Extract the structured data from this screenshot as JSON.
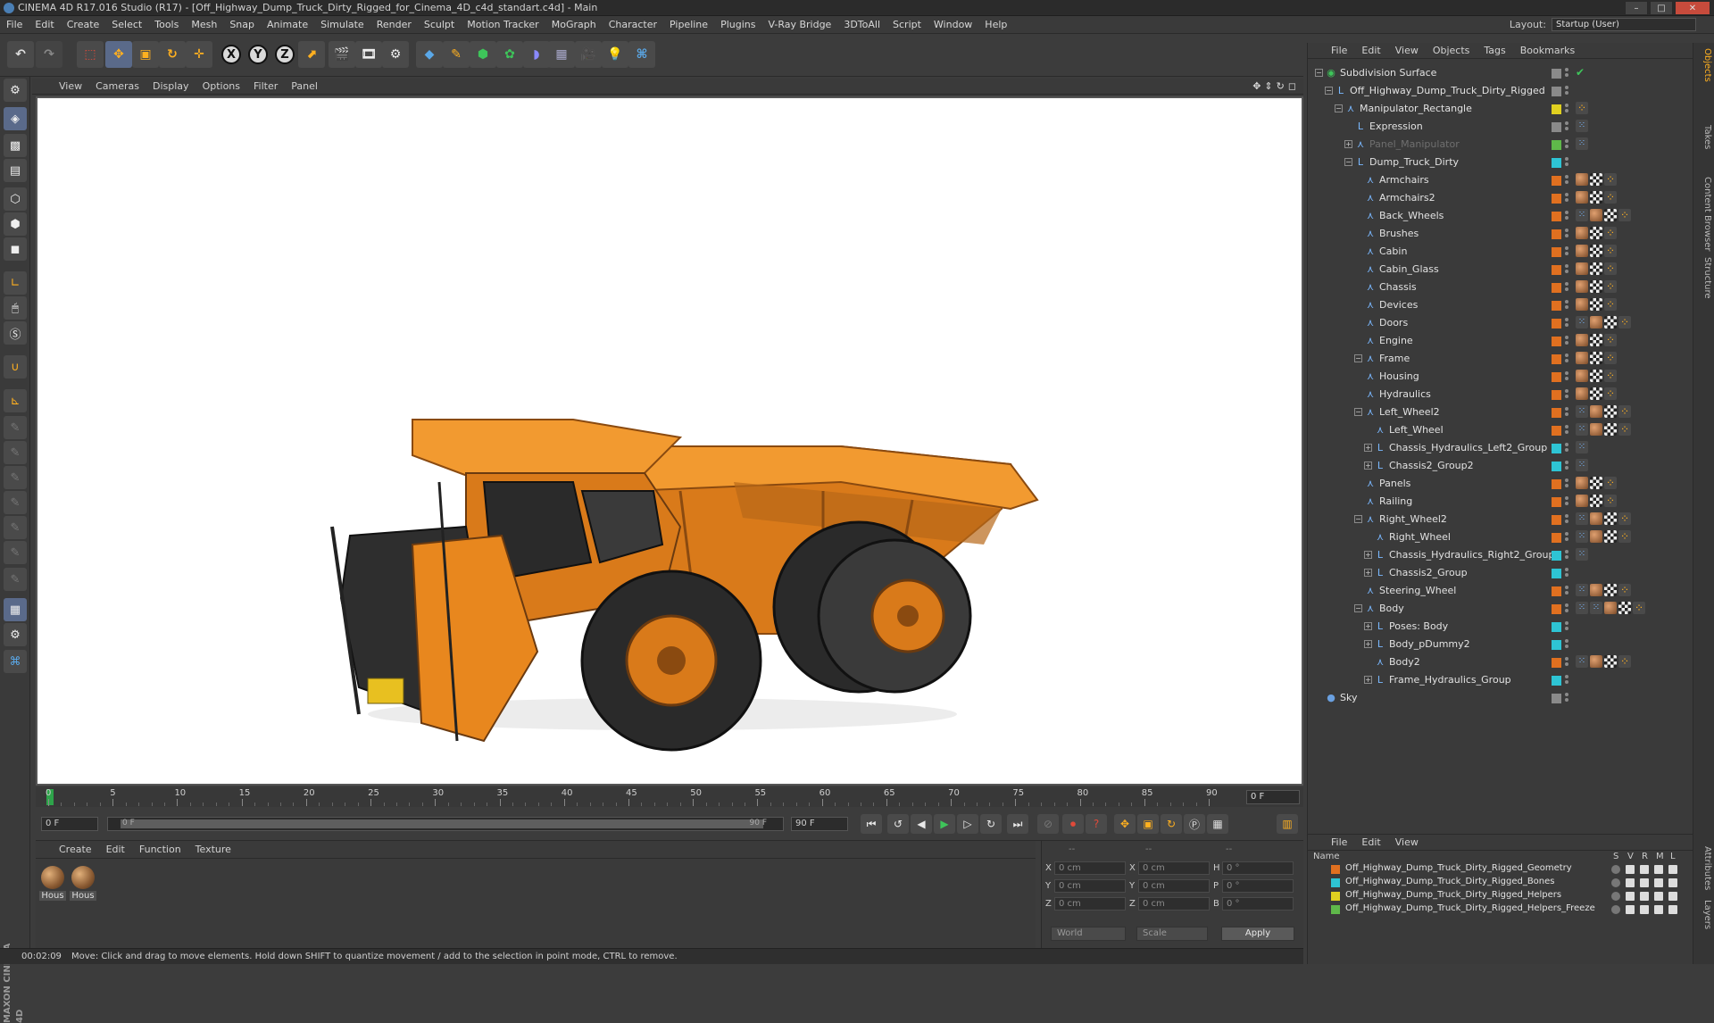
{
  "window": {
    "title": "CINEMA 4D R17.016 Studio (R17) - [Off_Highway_Dump_Truck_Dirty_Rigged_for_Cinema_4D_c4d_standart.c4d] - Main",
    "controls": [
      "–",
      "□",
      "✕"
    ]
  },
  "menubar": {
    "items": [
      "File",
      "Edit",
      "Create",
      "Select",
      "Tools",
      "Mesh",
      "Snap",
      "Animate",
      "Simulate",
      "Render",
      "Sculpt",
      "Motion Tracker",
      "MoGraph",
      "Character",
      "Pipeline",
      "Plugins",
      "V-Ray Bridge",
      "3DToAll",
      "Script",
      "Window",
      "Help"
    ],
    "layout_label": "Layout:",
    "layout_value": "Startup (User)"
  },
  "toolbar": {
    "axis_x": "X",
    "axis_y": "Y",
    "axis_z": "Z"
  },
  "viewport": {
    "menu": [
      "View",
      "Cameras",
      "Display",
      "Options",
      "Filter",
      "Panel"
    ],
    "colors": {
      "body": "#e8871e",
      "tire": "#2a2a2a",
      "rim": "#d97a1a"
    }
  },
  "timeline": {
    "ticks": [
      "0",
      "5",
      "10",
      "15",
      "20",
      "25",
      "30",
      "35",
      "40",
      "45",
      "50",
      "55",
      "60",
      "65",
      "70",
      "75",
      "80",
      "85",
      "90"
    ],
    "current_frame": "0 F"
  },
  "transport": {
    "start_field": "0 F",
    "slider_left": "0 F",
    "slider_right": "90 F",
    "end_field": "90 F"
  },
  "material_manager": {
    "menu": [
      "Create",
      "Edit",
      "Function",
      "Texture"
    ],
    "materials": [
      {
        "label": "Hous"
      },
      {
        "label": "Hous"
      }
    ]
  },
  "coordinates": {
    "headers": [
      "--",
      "--",
      "--"
    ],
    "rows": [
      {
        "a": "X",
        "v1": "0 cm",
        "b": "X",
        "v2": "0 cm",
        "c": "H",
        "v3": "0 °"
      },
      {
        "a": "Y",
        "v1": "0 cm",
        "b": "Y",
        "v2": "0 cm",
        "c": "P",
        "v3": "0 °"
      },
      {
        "a": "Z",
        "v1": "0 cm",
        "b": "Z",
        "v2": "0 cm",
        "c": "B",
        "v3": "0 °"
      }
    ],
    "mode": "World",
    "transform": "Scale",
    "apply": "Apply"
  },
  "status": {
    "time": "00:02:09",
    "message": "Move: Click and drag to move elements. Hold down SHIFT to quantize movement / add to the selection in point mode, CTRL to remove."
  },
  "object_manager": {
    "menu": [
      "File",
      "Edit",
      "View",
      "Objects",
      "Tags",
      "Bookmarks"
    ],
    "objects": [
      {
        "name": "Subdivision Surface",
        "indent": 0,
        "icon": "subdivision-icon",
        "layer": "#8a8a8a",
        "tags": [
          "check"
        ]
      },
      {
        "name": "Off_Highway_Dump_Truck_Dirty_Rigged",
        "indent": 1,
        "icon": "null-icon",
        "layer": "#8a8a8a",
        "tags": []
      },
      {
        "name": "Manipulator_Rectangle",
        "indent": 2,
        "icon": "joint-icon",
        "layer": "#e0d020",
        "tags": [
          "uv"
        ]
      },
      {
        "name": "Expression",
        "indent": 3,
        "icon": "null-icon",
        "layer": "#8a8a8a",
        "tags": [
          "rig"
        ]
      },
      {
        "name": "Panel_Manipulator",
        "indent": 3,
        "icon": "joint-icon",
        "layer": "#5fb84a",
        "tags": [
          "rig"
        ],
        "dim": true
      },
      {
        "name": "Dump_Truck_Dirty",
        "indent": 3,
        "icon": "null-icon",
        "layer": "#2ec4d4",
        "tags": []
      },
      {
        "name": "Armchairs",
        "indent": 4,
        "icon": "joint-icon",
        "layer": "#e07020",
        "tags": [
          "mat",
          "chk",
          "uv"
        ]
      },
      {
        "name": "Armchairs2",
        "indent": 4,
        "icon": "joint-icon",
        "layer": "#e07020",
        "tags": [
          "mat",
          "chk",
          "uv"
        ]
      },
      {
        "name": "Back_Wheels",
        "indent": 4,
        "icon": "joint-icon",
        "layer": "#e07020",
        "tags": [
          "rig",
          "mat",
          "chk",
          "uv"
        ]
      },
      {
        "name": "Brushes",
        "indent": 4,
        "icon": "joint-icon",
        "layer": "#e07020",
        "tags": [
          "mat",
          "chk",
          "uv"
        ]
      },
      {
        "name": "Cabin",
        "indent": 4,
        "icon": "joint-icon",
        "layer": "#e07020",
        "tags": [
          "mat",
          "chk",
          "uv"
        ]
      },
      {
        "name": "Cabin_Glass",
        "indent": 4,
        "icon": "joint-icon",
        "layer": "#e07020",
        "tags": [
          "mat",
          "chk",
          "uv"
        ]
      },
      {
        "name": "Chassis",
        "indent": 4,
        "icon": "joint-icon",
        "layer": "#e07020",
        "tags": [
          "mat",
          "chk",
          "uv"
        ]
      },
      {
        "name": "Devices",
        "indent": 4,
        "icon": "joint-icon",
        "layer": "#e07020",
        "tags": [
          "mat",
          "chk",
          "uv"
        ]
      },
      {
        "name": "Doors",
        "indent": 4,
        "icon": "joint-icon",
        "layer": "#e07020",
        "tags": [
          "rig",
          "mat",
          "chk",
          "uv"
        ]
      },
      {
        "name": "Engine",
        "indent": 4,
        "icon": "joint-icon",
        "layer": "#e07020",
        "tags": [
          "mat",
          "chk",
          "uv"
        ]
      },
      {
        "name": "Frame",
        "indent": 4,
        "icon": "joint-icon",
        "layer": "#e07020",
        "tags": [
          "mat",
          "chk",
          "uv"
        ],
        "expand": true
      },
      {
        "name": "Housing",
        "indent": 4,
        "icon": "joint-icon",
        "layer": "#e07020",
        "tags": [
          "mat",
          "chk",
          "uv"
        ]
      },
      {
        "name": "Hydraulics",
        "indent": 4,
        "icon": "joint-icon",
        "layer": "#e07020",
        "tags": [
          "mat",
          "chk",
          "uv"
        ]
      },
      {
        "name": "Left_Wheel2",
        "indent": 4,
        "icon": "joint-icon",
        "layer": "#e07020",
        "tags": [
          "rig",
          "mat",
          "chk",
          "uv"
        ],
        "expand": true
      },
      {
        "name": "Left_Wheel",
        "indent": 5,
        "icon": "joint-icon",
        "layer": "#e07020",
        "tags": [
          "rig",
          "mat",
          "chk",
          "uv"
        ]
      },
      {
        "name": "Chassis_Hydraulics_Left2_Group",
        "indent": 5,
        "icon": "null-icon",
        "layer": "#2ec4d4",
        "tags": [
          "rig"
        ],
        "expand": true
      },
      {
        "name": "Chassis2_Group2",
        "indent": 5,
        "icon": "null-icon",
        "layer": "#2ec4d4",
        "tags": [
          "rig"
        ],
        "expand": true
      },
      {
        "name": "Panels",
        "indent": 4,
        "icon": "joint-icon",
        "layer": "#e07020",
        "tags": [
          "mat",
          "chk",
          "uv"
        ]
      },
      {
        "name": "Railing",
        "indent": 4,
        "icon": "joint-icon",
        "layer": "#e07020",
        "tags": [
          "mat",
          "chk",
          "uv"
        ]
      },
      {
        "name": "Right_Wheel2",
        "indent": 4,
        "icon": "joint-icon",
        "layer": "#e07020",
        "tags": [
          "rig",
          "mat",
          "chk",
          "uv"
        ],
        "expand": true
      },
      {
        "name": "Right_Wheel",
        "indent": 5,
        "icon": "joint-icon",
        "layer": "#e07020",
        "tags": [
          "rig",
          "mat",
          "chk",
          "uv"
        ]
      },
      {
        "name": "Chassis_Hydraulics_Right2_Group",
        "indent": 5,
        "icon": "null-icon",
        "layer": "#2ec4d4",
        "tags": [
          "rig"
        ],
        "expand": true
      },
      {
        "name": "Chassis2_Group",
        "indent": 5,
        "icon": "null-icon",
        "layer": "#2ec4d4",
        "tags": [],
        "expand": true
      },
      {
        "name": "Steering_Wheel",
        "indent": 4,
        "icon": "joint-icon",
        "layer": "#e07020",
        "tags": [
          "rig",
          "mat",
          "chk",
          "uv"
        ]
      },
      {
        "name": "Body",
        "indent": 4,
        "icon": "joint-icon",
        "layer": "#e07020",
        "tags": [
          "rig",
          "rig",
          "mat",
          "chk",
          "uv"
        ],
        "expand": true
      },
      {
        "name": "Poses: Body",
        "indent": 5,
        "icon": "null-icon",
        "layer": "#2ec4d4",
        "tags": [],
        "expand": true
      },
      {
        "name": "Body_pDummy2",
        "indent": 5,
        "icon": "null-icon",
        "layer": "#2ec4d4",
        "tags": [],
        "expand": true
      },
      {
        "name": "Body2",
        "indent": 5,
        "icon": "joint-icon",
        "layer": "#e07020",
        "tags": [
          "rig",
          "mat",
          "chk",
          "uv"
        ]
      },
      {
        "name": "Frame_Hydraulics_Group",
        "indent": 5,
        "icon": "null-icon",
        "layer": "#2ec4d4",
        "tags": [],
        "expand": true
      },
      {
        "name": "Sky",
        "indent": 0,
        "icon": "sky-icon",
        "layer": "#8a8a8a",
        "tags": []
      }
    ]
  },
  "layer_manager": {
    "menu": [
      "File",
      "Edit",
      "View"
    ],
    "columns": [
      "Name",
      "S",
      "V",
      "R",
      "M",
      "L"
    ],
    "layers": [
      {
        "name": "Off_Highway_Dump_Truck_Dirty_Rigged_Geometry",
        "color": "#e07020"
      },
      {
        "name": "Off_Highway_Dump_Truck_Dirty_Rigged_Bones",
        "color": "#2ec4d4"
      },
      {
        "name": "Off_Highway_Dump_Truck_Dirty_Rigged_Helpers",
        "color": "#e0d020"
      },
      {
        "name": "Off_Highway_Dump_Truck_Dirty_Rigged_Helpers_Freeze",
        "color": "#5fb84a"
      }
    ]
  },
  "right_tabs": [
    "Objects",
    "Takes",
    "Content Browser",
    "Structure",
    "Attributes",
    "Layers"
  ]
}
